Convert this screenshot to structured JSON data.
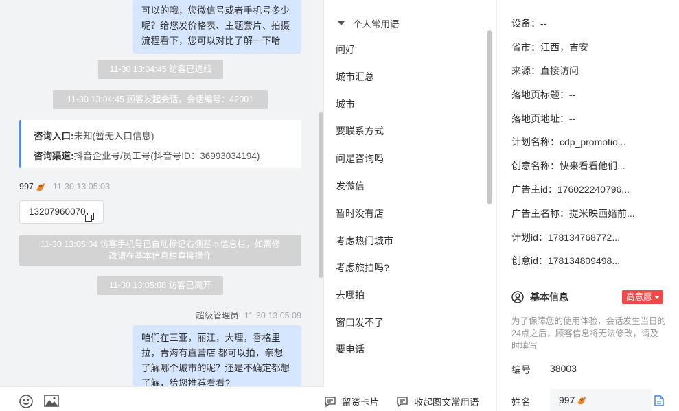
{
  "chat": {
    "top_bubble_lines": [
      "可以的哦，您微信号或者手机号多少",
      "呢？给您发价格表、主题套片、拍摄",
      "流程看下，您可以对比了解一下哈"
    ],
    "sys_visitor_entered": "11-30 13:04:45 访客已进线",
    "sys_session_started": "11-30 13:04:45 顾客发起会话，会话编号：42001",
    "inquiry_entry_label": "咨询入口:",
    "inquiry_entry_value": "未知(暂无入口信息)",
    "inquiry_channel_label": "咨询渠道:",
    "inquiry_channel_value": "抖音企业号/员工号(抖音号ID：36993034194)",
    "visitor_name": "997",
    "visitor_time": "11-30 13:05:03",
    "visitor_phone": "13207960070",
    "sys_phone_marked_line1": "11-30 13:05:04 访客手机号已自动标记右侧基本信息栏，如需修",
    "sys_phone_marked_line2": "改请在基本信息栏直接操作",
    "sys_visitor_left": "11-30 13:05:08 访客已离开",
    "admin_name": "超级管理员",
    "admin_time": "11-30 13:05:09",
    "bottom_bubble_lines": [
      "咱们在三亚，丽江，大理，香格里",
      "拉，青海有直营店 都可以拍，亲想",
      "了解哪个城市的呢？还是不确定都想",
      "了解，给您推荐看看?"
    ],
    "toolbar_icons": [
      "emoji-icon",
      "image-icon"
    ]
  },
  "phrases": {
    "group_title": "个人常用语",
    "items": [
      "问好",
      "城市汇总",
      "城市",
      "要联系方式",
      "问是咨询吗",
      "发微信",
      "暂时没有店",
      "考虑热门城市",
      "考虑旅拍吗?",
      "去哪拍",
      "窗口发不了",
      "要电话"
    ],
    "footer_card": "留资卡片",
    "footer_collect": "收起图文常用语"
  },
  "details": {
    "rows": [
      "设备：--",
      "省市：江西，吉安",
      "来源：直接访问",
      "落地页标题：--",
      "落地页地址：--",
      "计划名称：cdp_promotio...",
      "创意名称：快来看看他们...",
      "广告主id：176022240796...",
      "广告主名称：提米映画婚前...",
      "计划id：178134768772...",
      "创意id：178134809498..."
    ],
    "basic_info_title": "基本信息",
    "intent_badge": "高意愿",
    "notice": "为了保障您的使用体验，会话发生当日的24点之后，顾客信息将无法修改，请及时填写",
    "id_label": "编号",
    "id_value": "38003",
    "name_label": "姓名",
    "name_value": "997",
    "colors": {
      "accent_blue": "#4a8ef5",
      "badge_red": "#f04a4a",
      "bubble_blue": "#d6e6ff"
    }
  }
}
